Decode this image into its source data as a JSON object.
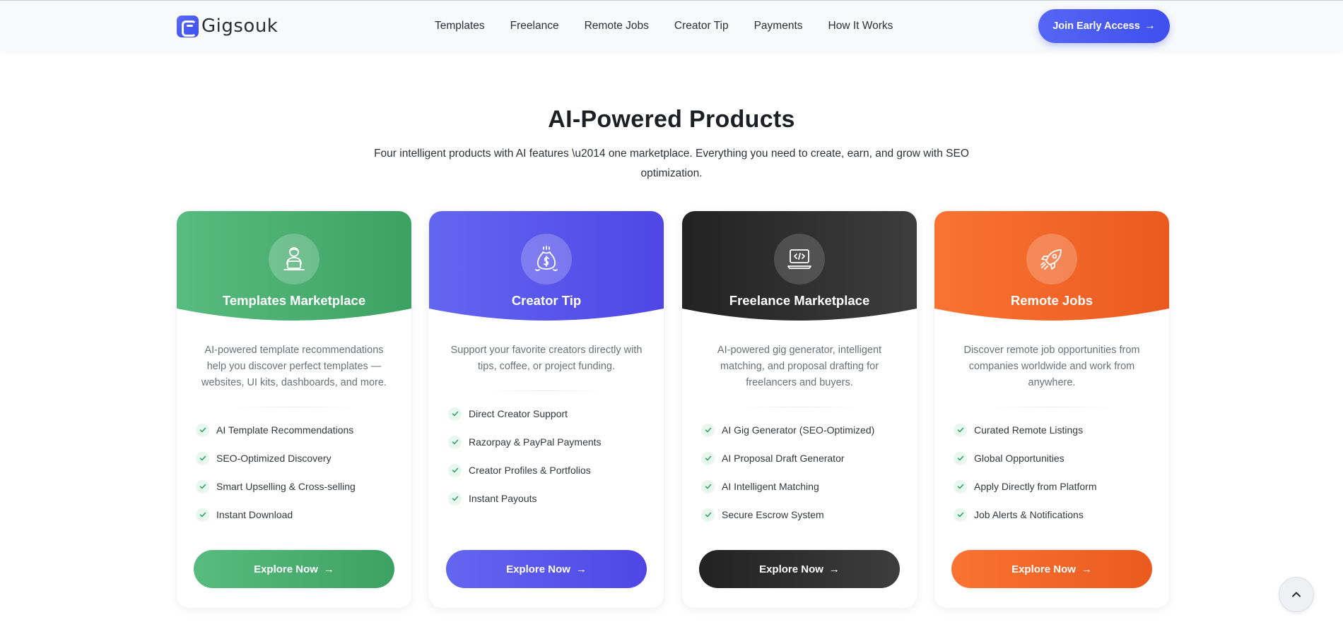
{
  "brand": {
    "name": "Gigsouk"
  },
  "nav": {
    "items": [
      "Templates",
      "Freelance",
      "Remote Jobs",
      "Creator Tip",
      "Payments",
      "How It Works"
    ],
    "cta_label": "Join Early Access"
  },
  "section": {
    "title": "AI-Powered Products",
    "subtitle": "Four intelligent products with AI features \\u2014 one marketplace. Everything you need to create, earn, and grow with SEO optimization."
  },
  "cards": [
    {
      "title": "Templates Marketplace",
      "icon": "user-laptop-icon",
      "color_start": "#58bb7f",
      "color_end": "#3ca263",
      "description": "AI-powered template recommendations help you discover perfect templates — websites, UI kits, dashboards, and more.",
      "features": [
        "AI Template Recommendations",
        "SEO-Optimized Discovery",
        "Smart Upselling & Cross-selling",
        "Instant Download"
      ],
      "button_label": "Explore Now"
    },
    {
      "title": "Creator Tip",
      "icon": "money-bag-icon",
      "color_start": "#6366f1",
      "color_end": "#4f46e5",
      "description": "Support your favorite creators directly with tips, coffee, or project funding.",
      "features": [
        "Direct Creator Support",
        "Razorpay & PayPal Payments",
        "Creator Profiles & Portfolios",
        "Instant Payouts"
      ],
      "button_label": "Explore Now"
    },
    {
      "title": "Freelance Marketplace",
      "icon": "code-laptop-icon",
      "color_start": "#222222",
      "color_end": "#3d3d3d",
      "description": "AI-powered gig generator, intelligent matching, and proposal drafting for freelancers and buyers.",
      "features": [
        "AI Gig Generator (SEO-Optimized)",
        "AI Proposal Draft Generator",
        "AI Intelligent Matching",
        "Secure Escrow System"
      ],
      "button_label": "Explore Now"
    },
    {
      "title": "Remote Jobs",
      "icon": "rocket-icon",
      "color_start": "#f97332",
      "color_end": "#ea5a1f",
      "description": "Discover remote job opportunities from companies worldwide and work from anywhere.",
      "features": [
        "Curated Remote Listings",
        "Global Opportunities",
        "Apply Directly from Platform",
        "Job Alerts & Notifications"
      ],
      "button_label": "Explore Now"
    }
  ]
}
